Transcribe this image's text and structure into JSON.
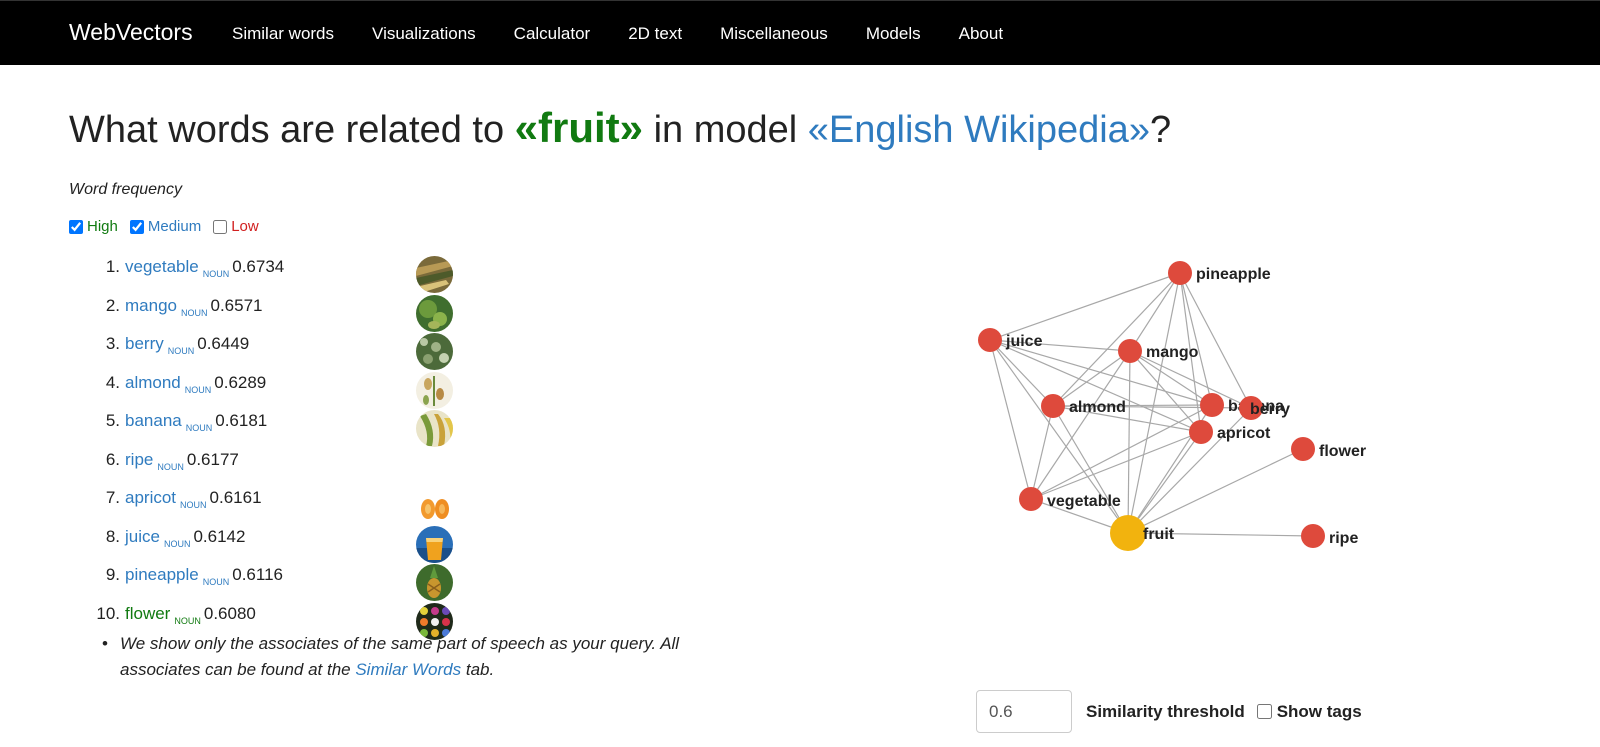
{
  "nav": {
    "brand": "WebVectors",
    "links": [
      "Similar words",
      "Visualizations",
      "Calculator",
      "2D text",
      "Miscellaneous",
      "Models",
      "About"
    ]
  },
  "heading": {
    "prefix": "What words are related to ",
    "query": "«fruit»",
    "middle": " in model ",
    "model": "«English Wikipedia»",
    "suffix": "?"
  },
  "frequency": {
    "label": "Word frequency",
    "options": [
      {
        "label": "High",
        "checked": true
      },
      {
        "label": "Medium",
        "checked": true
      },
      {
        "label": "Low",
        "checked": false
      }
    ]
  },
  "results": [
    {
      "rank": "1.",
      "word": "vegetable",
      "pos": "NOUN",
      "score": "0.6734",
      "freq": "medium"
    },
    {
      "rank": "2.",
      "word": "mango",
      "pos": "NOUN",
      "score": "0.6571",
      "freq": "medium"
    },
    {
      "rank": "3.",
      "word": "berry",
      "pos": "NOUN",
      "score": "0.6449",
      "freq": "medium"
    },
    {
      "rank": "4.",
      "word": "almond",
      "pos": "NOUN",
      "score": "0.6289",
      "freq": "medium"
    },
    {
      "rank": "5.",
      "word": "banana",
      "pos": "NOUN",
      "score": "0.6181",
      "freq": "medium"
    },
    {
      "rank": "6.",
      "word": "ripe",
      "pos": "NOUN",
      "score": "0.6177",
      "freq": "medium"
    },
    {
      "rank": "7.",
      "word": "apricot",
      "pos": "NOUN",
      "score": "0.6161",
      "freq": "medium"
    },
    {
      "rank": "8.",
      "word": "juice",
      "pos": "NOUN",
      "score": "0.6142",
      "freq": "medium"
    },
    {
      "rank": "9.",
      "word": "pineapple",
      "pos": "NOUN",
      "score": "0.6116",
      "freq": "medium"
    },
    {
      "rank": "10.",
      "word": "flower",
      "pos": "NOUN",
      "score": "0.6080",
      "freq": "high"
    }
  ],
  "note": {
    "bullet": "•",
    "text_before": "We show only the associates of the same part of speech as your query. All associates can be found at the ",
    "link": "Similar Words",
    "text_after": " tab."
  },
  "graph": {
    "node_color": "#de4a3c",
    "query_color": "#f2b30e",
    "edge_color": "#a8a8a8",
    "nodes": [
      "pineapple",
      "juice",
      "mango",
      "almond",
      "banana",
      "berry",
      "apricot",
      "flower",
      "vegetable",
      "fruit",
      "ripe"
    ],
    "query": "fruit"
  },
  "controls": {
    "threshold_value": "0.6",
    "threshold_label": "Similarity threshold",
    "show_tags_label": "Show tags"
  }
}
